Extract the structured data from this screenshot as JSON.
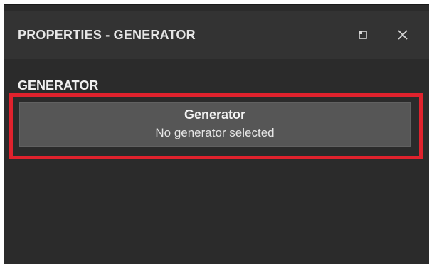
{
  "panel": {
    "title": "PROPERTIES - GENERATOR",
    "restore_icon": "restore-icon",
    "close_icon": "close-icon"
  },
  "section": {
    "title": "GENERATOR"
  },
  "generator_field": {
    "label": "Generator",
    "value": "No generator selected"
  },
  "colors": {
    "panel_bg": "#2b2b2b",
    "titlebar_bg": "#333333",
    "field_bg": "#565656",
    "highlight": "#e0222d"
  }
}
